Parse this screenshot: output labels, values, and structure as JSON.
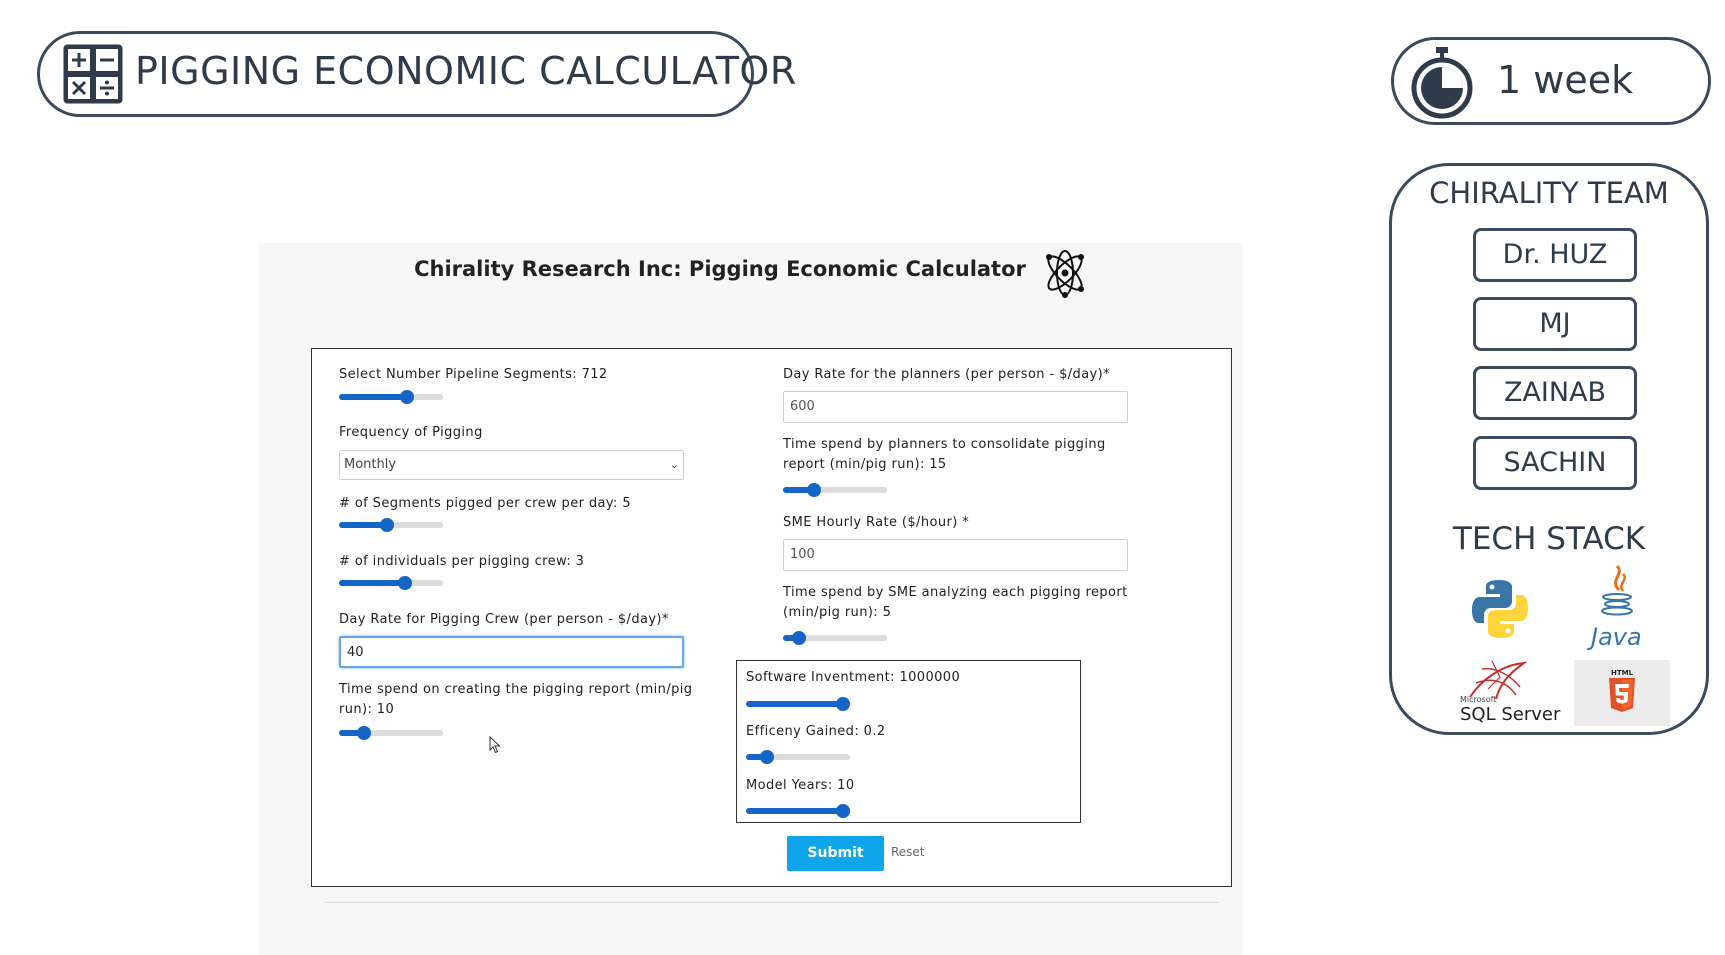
{
  "header": {
    "title": "PIGGING ECONOMIC CALCULATOR",
    "icon": "calculator-icon"
  },
  "duration": {
    "label": "1 week",
    "icon": "timer-icon"
  },
  "team": {
    "heading": "CHIRALITY TEAM",
    "members": [
      "Dr. HUZ",
      "MJ",
      "ZAINAB",
      "SACHIN"
    ],
    "tech_heading": "TECH STACK",
    "tech": [
      {
        "name": "python",
        "icon": "python-logo-icon"
      },
      {
        "name": "Java",
        "icon": "java-logo-icon"
      },
      {
        "name": "SQL Server",
        "small": "Microsoft",
        "icon": "sql-server-logo-icon"
      },
      {
        "name": "HTML",
        "icon": "html5-logo-icon"
      }
    ]
  },
  "app": {
    "title": "Chirality Research Inc: Pigging Economic Calculator",
    "icon": "atom-icon",
    "left": {
      "segments_label": "Select Number Pipeline Segments: 712",
      "segments_level": 0.68,
      "frequency_label": "Frequency of Pigging",
      "frequency_value": "Monthly",
      "seg_per_crew_label": "# of Segments pigged per crew per day: 5",
      "seg_per_crew_level": 0.45,
      "individuals_label": "# of individuals per pigging crew: 3",
      "individuals_level": 0.65,
      "crew_rate_label": "Day Rate for Pigging Crew (per person - $/day)*",
      "crew_rate_value": "40",
      "report_time_label_1": "Time spend on creating the pigging report (min/pig",
      "report_time_label_2": "run): 10",
      "report_time_level": 0.2
    },
    "right": {
      "planner_rate_label": "Day Rate for the planners (per person - $/day)*",
      "planner_rate_value": "600",
      "planner_time_label_1": "Time spend by planners to consolidate pigging",
      "planner_time_label_2": "report (min/pig run): 15",
      "planner_time_level": 0.27,
      "sme_rate_label": "SME Hourly Rate ($/hour) *",
      "sme_rate_value": "100",
      "sme_time_label_1": "Time spend by SME analyzing each pigging report",
      "sme_time_label_2": "(min/pig run): 5",
      "sme_time_level": 0.1,
      "software_label": "Software Invent\u0000ment: 1000000",
      "software_level": 1.0,
      "efficiency_label": "Efficeny Gained: 0.2",
      "efficiency_level": 0.15,
      "years_label": "Model Years: 10",
      "years_level": 1.0
    },
    "submit_label": "Submit",
    "reset_label": "Reset"
  },
  "colors": {
    "outline": "#3b4a5c",
    "slider": "#1565c8",
    "submit": "#0ea5ea"
  }
}
